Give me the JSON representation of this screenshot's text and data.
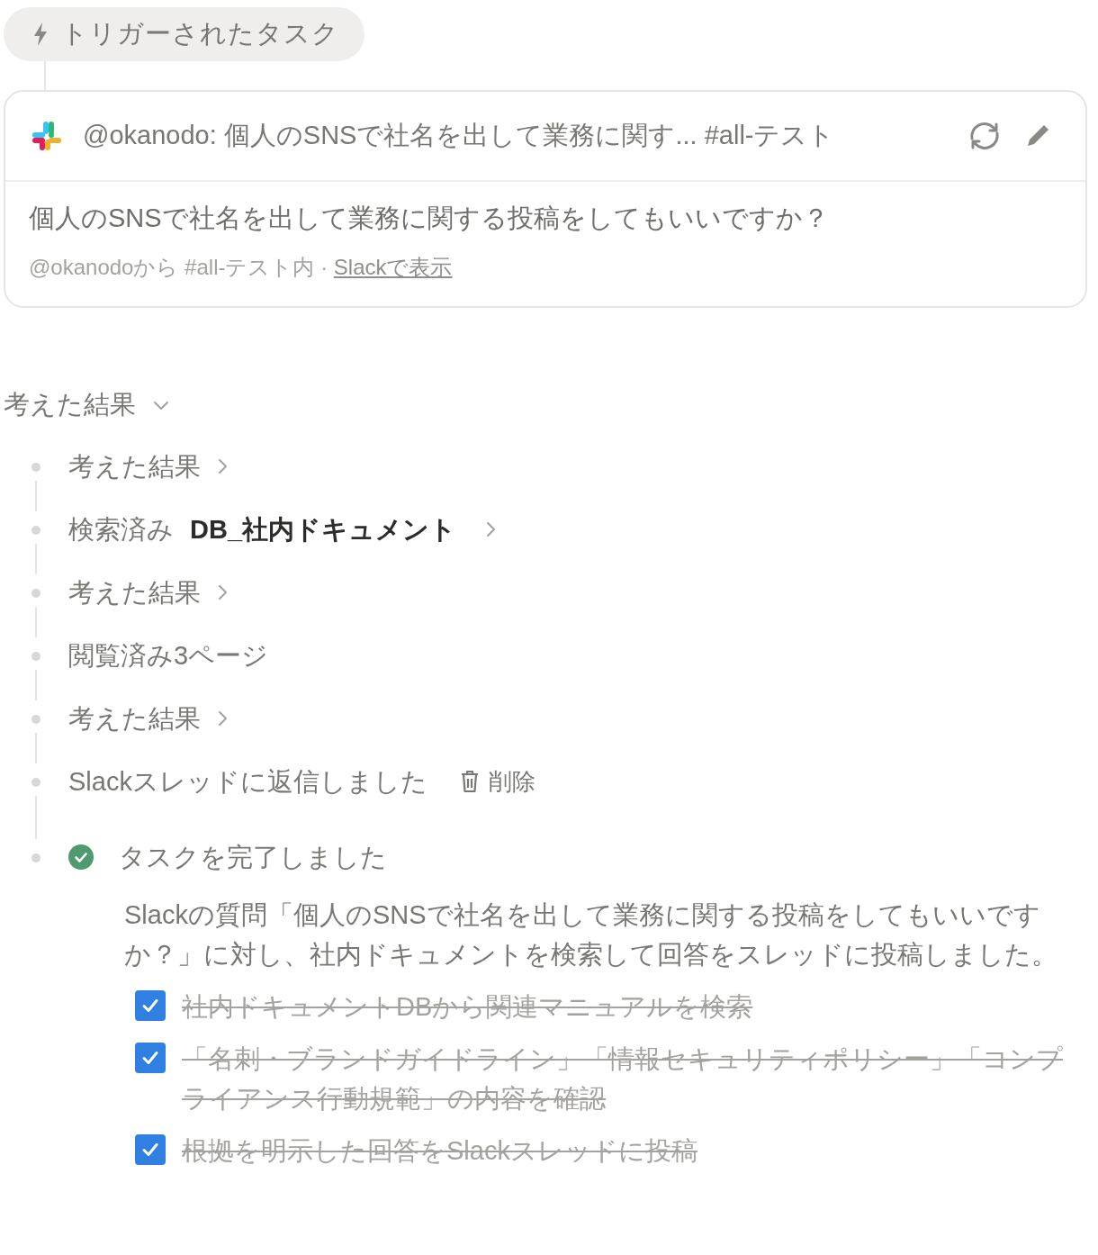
{
  "trigger": {
    "label": "トリガーされたタスク"
  },
  "card": {
    "title": "@okanodo: 個人のSNSで社名を出して業務に関す... #all-テスト",
    "question": "個人のSNSで社名を出して業務に関する投稿をしてもいいですか？",
    "meta": "@okanodoから #all-テスト内 · ",
    "link": "Slackで表示"
  },
  "section": {
    "title": "考えた結果",
    "expanded": true
  },
  "steps": [
    {
      "kind": "thought",
      "label": "考えた結果"
    },
    {
      "kind": "search",
      "label": "検索済み",
      "target": "DB_社内ドキュメント"
    },
    {
      "kind": "thought",
      "label": "考えた結果"
    },
    {
      "kind": "plain",
      "label": "閲覧済み3ページ"
    },
    {
      "kind": "thought",
      "label": "考えた結果"
    },
    {
      "kind": "action",
      "label": "Slackスレッドに返信しました",
      "action": "削除"
    },
    {
      "kind": "done",
      "label": "タスクを完了しました",
      "summary": "Slackの質問「個人のSNSで社名を出して業務に関する投稿をしてもいいですか？」に対し、社内ドキュメントを検索して回答をスレッドに投稿しました。",
      "checklist": [
        {
          "text": "社内ドキュメントDBから関連マニュアルを検索",
          "checked": true
        },
        {
          "text": "「名刺・ブランドガイドライン」「情報セキュリティポリシー」「コンプライアンス行動規範」の内容を確認",
          "checked": true
        },
        {
          "text": "根拠を明示した回答をSlackスレッドに投稿",
          "checked": true
        }
      ]
    }
  ]
}
